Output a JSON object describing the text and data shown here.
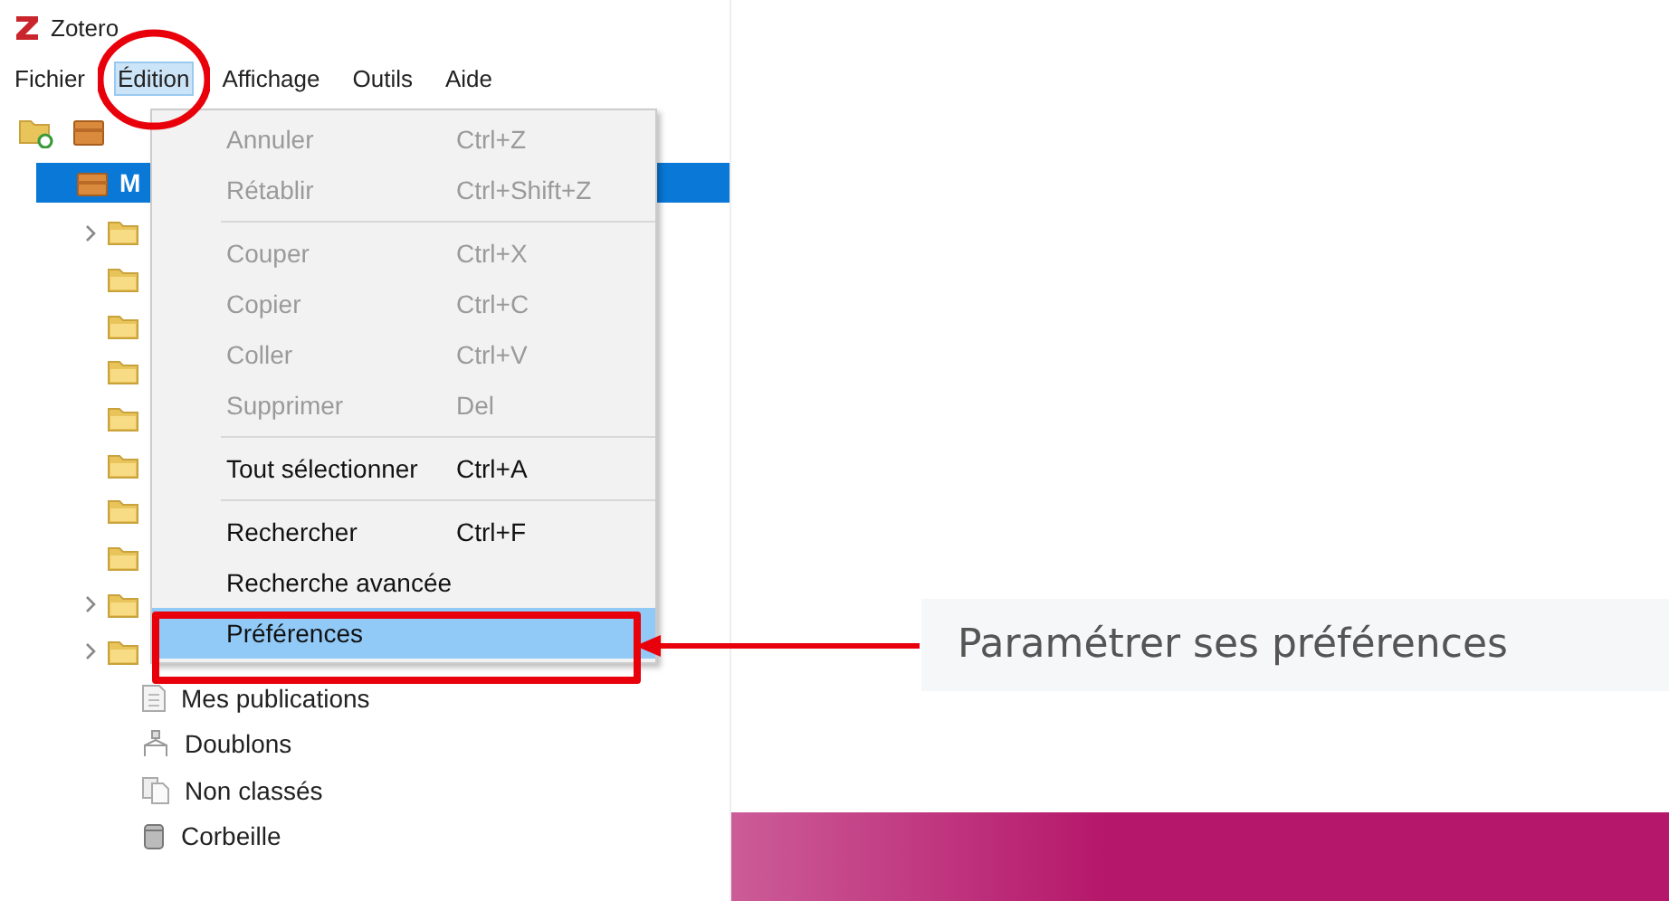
{
  "app": {
    "title": "Zotero",
    "menus": [
      {
        "label": "Fichier",
        "selected": false
      },
      {
        "label": "Édition",
        "selected": true
      },
      {
        "label": "Affichage",
        "selected": false
      },
      {
        "label": "Outils",
        "selected": false
      },
      {
        "label": "Aide",
        "selected": false
      }
    ],
    "tree": {
      "library": {
        "label": "M",
        "selected": true
      },
      "folders": [
        {
          "expandable": true
        },
        {
          "expandable": false
        },
        {
          "expandable": false
        },
        {
          "expandable": false
        },
        {
          "expandable": false
        },
        {
          "expandable": false
        },
        {
          "expandable": false
        },
        {
          "expandable": false
        },
        {
          "expandable": true
        },
        {
          "expandable": true
        }
      ],
      "special": [
        {
          "kind": "publications",
          "label": "Mes publications"
        },
        {
          "kind": "duplicates",
          "label": "Doublons"
        },
        {
          "kind": "unfiled",
          "label": "Non classés"
        },
        {
          "kind": "trash",
          "label": "Corbeille"
        }
      ]
    },
    "edit_menu": [
      {
        "kind": "item",
        "label": "Annuler",
        "shortcut": "Ctrl+Z",
        "disabled": true,
        "selected": false
      },
      {
        "kind": "item",
        "label": "Rétablir",
        "shortcut": "Ctrl+Shift+Z",
        "disabled": true,
        "selected": false
      },
      {
        "kind": "separator"
      },
      {
        "kind": "item",
        "label": "Couper",
        "shortcut": "Ctrl+X",
        "disabled": true,
        "selected": false
      },
      {
        "kind": "item",
        "label": "Copier",
        "shortcut": "Ctrl+C",
        "disabled": true,
        "selected": false
      },
      {
        "kind": "item",
        "label": "Coller",
        "shortcut": "Ctrl+V",
        "disabled": true,
        "selected": false
      },
      {
        "kind": "item",
        "label": "Supprimer",
        "shortcut": "Del",
        "disabled": true,
        "selected": false
      },
      {
        "kind": "separator"
      },
      {
        "kind": "item",
        "label": "Tout sélectionner",
        "shortcut": "Ctrl+A",
        "disabled": false,
        "selected": false
      },
      {
        "kind": "separator"
      },
      {
        "kind": "item",
        "label": "Rechercher",
        "shortcut": "Ctrl+F",
        "disabled": false,
        "selected": false
      },
      {
        "kind": "item",
        "label": "Recherche avancée",
        "disabled": false,
        "selected": false
      },
      {
        "kind": "item",
        "label": "Préférences",
        "disabled": false,
        "selected": true
      }
    ]
  },
  "annotation": {
    "callout": "Paramétrer ses préférences"
  }
}
